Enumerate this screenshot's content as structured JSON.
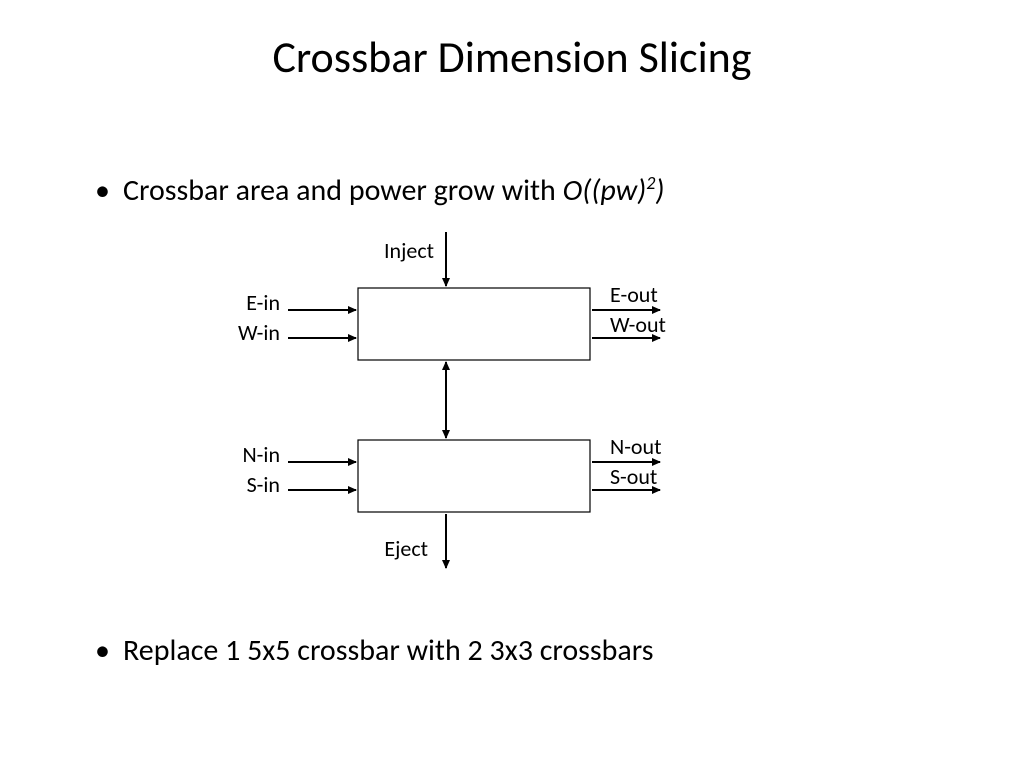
{
  "title": "Crossbar Dimension Slicing",
  "bullet1_prefix": "Crossbar area and power grow with ",
  "bullet1_formula_open": "O((pw)",
  "bullet1_formula_exp": "2",
  "bullet1_formula_close": ")",
  "bullet2": "Replace 1 5x5 crossbar with 2 3x3 crossbars",
  "labels": {
    "inject": "Inject",
    "eject": "Eject",
    "e_in": "E-in",
    "w_in": "W-in",
    "e_out": "E-out",
    "w_out": "W-out",
    "n_in": "N-in",
    "s_in": "S-in",
    "n_out": "N-out",
    "s_out": "S-out"
  }
}
